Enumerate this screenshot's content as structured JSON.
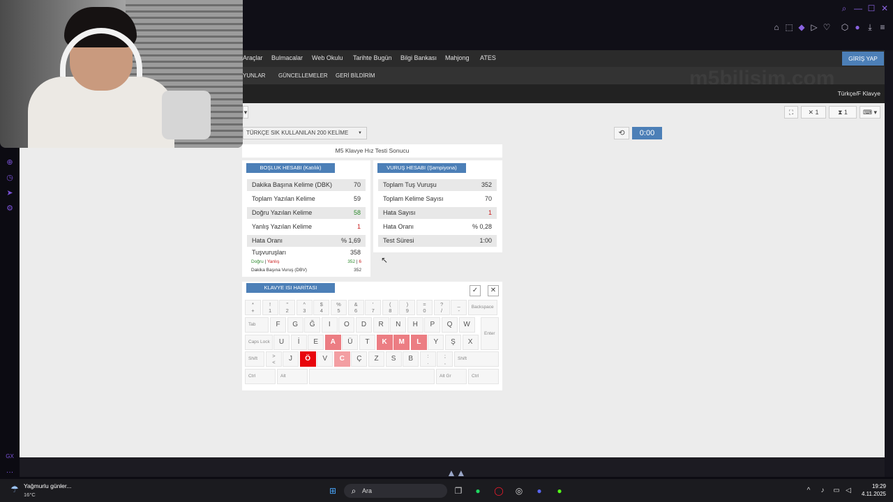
{
  "nav": {
    "menu": [
      "Araçlar",
      "Bulmacalar",
      "Web Okulu",
      "Tarihte Bugün",
      "Bilgi Bankası",
      "Mahjong",
      "ATES"
    ],
    "submenu": [
      "YUNLAR",
      "GÜNCELLEMELER",
      "GERİ BİLDİRİM"
    ],
    "login": "GİRİŞ YAP",
    "watermark": "m5bilisim.com",
    "layout": "Türkçe/F Klavye"
  },
  "toolbar": {
    "close_count": "1",
    "timer_count": "1",
    "word_list": "TÜRKÇE SIK KULLANILAN 200 KELİME",
    "timer": "0:00"
  },
  "result": {
    "title": "M5 Klavye Hız Testi Sonucu",
    "left": {
      "tag": "BOŞLUK HESABI (Katılık)",
      "rows": [
        {
          "label": "Dakika Başına Kelime (DBK)",
          "value": "70"
        },
        {
          "label": "Toplam Yazılan Kelime",
          "value": "59"
        },
        {
          "label": "Doğru Yazılan Kelime",
          "value": "58"
        },
        {
          "label": "Yanlış Yazılan Kelime",
          "value": "1"
        },
        {
          "label": "Hata Oranı",
          "value": "% 1,69"
        }
      ],
      "keystrokes_label": "Tuşvuruşları",
      "keystrokes_value": "358",
      "correct_label": "Doğru",
      "sep": "|",
      "wrong_label": "Yanlış",
      "correct_value": "352",
      "wrong_value": "6",
      "dbv_label": "Dakika Başına Vuruş (DBV)",
      "dbv_value": "352"
    },
    "right": {
      "tag": "VURUŞ HESABI (Şampiyona)",
      "rows": [
        {
          "label": "Toplam Tuş Vuruşu",
          "value": "352"
        },
        {
          "label": "Toplam Kelime Sayısı",
          "value": "70"
        },
        {
          "label": "Hata Sayısı",
          "value": "1"
        },
        {
          "label": "Hata Oranı",
          "value": "% 0,28"
        },
        {
          "label": "Test Süresi",
          "value": "1:00"
        }
      ]
    }
  },
  "heatmap": {
    "tag": "KLAVYE ISI HARİTASI",
    "row0": [
      [
        "*",
        "+"
      ],
      [
        "!",
        "1"
      ],
      [
        "\"",
        "2"
      ],
      [
        "^",
        "3"
      ],
      [
        "$",
        "4"
      ],
      [
        "%",
        "5"
      ],
      [
        "&",
        "6"
      ],
      [
        "'",
        "7"
      ],
      [
        "(",
        "8"
      ],
      [
        ")",
        "9"
      ],
      [
        "=",
        "0"
      ],
      [
        "?",
        "/"
      ],
      [
        "_",
        "-"
      ]
    ],
    "backspace": "Backspace",
    "tab": "Tab",
    "row1": [
      "F",
      "G",
      "Ğ",
      "I",
      "O",
      "D",
      "R",
      "N",
      "H",
      "P",
      "Q",
      "W"
    ],
    "enter": "Enter",
    "caps": "Caps Lock",
    "row2": [
      "U",
      "İ",
      "E",
      "A",
      "Ü",
      "T",
      "K",
      "M",
      "L",
      "Y",
      "Ş",
      "X"
    ],
    "shift_l": "Shift",
    "angle": [
      ">",
      "<"
    ],
    "row3": [
      "J",
      "Ö",
      "V",
      "C",
      "Ç",
      "Z",
      "S",
      "B"
    ],
    "dot": [
      ":",
      "."
    ],
    "comma": [
      ";",
      ","
    ],
    "shift_r": "Shift",
    "ctrl": "Ctrl",
    "alt": "Alt",
    "altgr": "Alt Gr",
    "heat_keys": {
      "A": "warm",
      "K": "warm",
      "M": "warm",
      "L": "warm",
      "Ö": "hot",
      "C": "light"
    },
    "colors": {
      "warm": "#ec7d83",
      "hot": "#e8060c",
      "light": "#f39ea2"
    }
  },
  "taskbar": {
    "weather": "Yağmurlu günler...",
    "temp": "16°C",
    "search": "Ara",
    "time": "19:29",
    "date": "4.11.2025"
  },
  "icons": {
    "accent": "#4c7fb7",
    "browser_accent": "#7a52d8"
  }
}
